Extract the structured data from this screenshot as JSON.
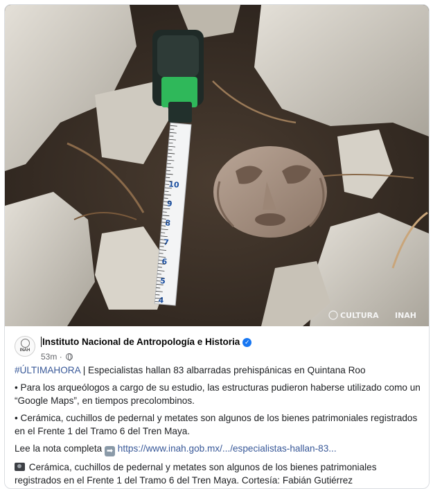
{
  "post": {
    "photo": {
      "alt_subject": "carved stone face next to measuring tape",
      "watermark_cultura": "CULTURA",
      "watermark_inah": "INAH",
      "tape_numbers": [
        "10",
        "9",
        "8",
        "7",
        "6",
        "5",
        "4"
      ]
    },
    "author": {
      "avatar_abbr": "INAH",
      "name": "Instituto Nacional de Antropología e Historia",
      "verified_icon": "check-badge-icon",
      "time": "53m",
      "separator": "·",
      "privacy_icon": "globe-icon"
    },
    "paragraphs": {
      "headline_hashtag": "#ÚLTIMAHORA",
      "headline_text": " | Especialistas hallan 83 albarradas prehispánicas en Quintana Roo",
      "bullet1": "• Para los arqueólogos a cargo de su estudio, las estructuras pudieron haberse utilizado como un “Google Maps”, en tiempos precolombinos.",
      "bullet2": "• Cerámica, cuchillos de pedernal y metates son algunos de los bienes patrimoniales registrados en el Frente 1 del Tramo 6 del Tren Maya.",
      "read_more_label": "Lee la nota completa ",
      "arrow_emoji": "➡",
      "read_more_link": "https://www.inah.gob.mx/.../especialistas-hallan-83...",
      "caption": "Cerámica, cuchillos de pedernal y metates son algunos de los bienes patrimoniales registrados en el Frente 1 del Tramo 6 del Tren Maya. Cortesía: Fabián Gutiérrez"
    },
    "colors": {
      "link": "#385898",
      "verified": "#1877f2",
      "secondary_text": "#65676b"
    }
  }
}
